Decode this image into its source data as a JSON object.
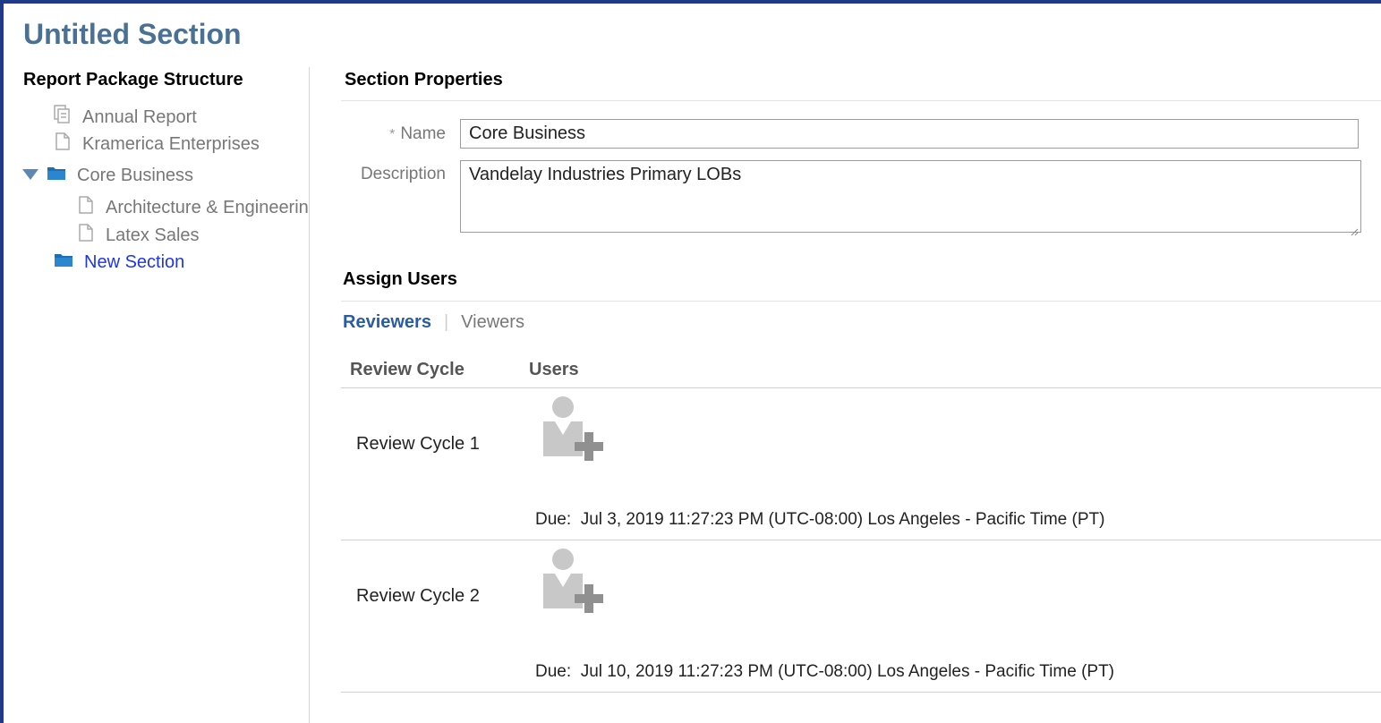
{
  "page": {
    "title": "Untitled Section"
  },
  "tree": {
    "title": "Report Package Structure",
    "items": [
      {
        "label": "Annual Report",
        "icon": "report-package-icon"
      },
      {
        "label": "Kramerica Enterprises",
        "icon": "document-icon"
      },
      {
        "label": "Core Business",
        "icon": "folder-icon",
        "expanded": true
      },
      {
        "label": "Architecture & Engineering",
        "icon": "document-icon"
      },
      {
        "label": "Latex Sales",
        "icon": "document-icon"
      },
      {
        "label": "New Section",
        "icon": "folder-icon",
        "selected": true
      }
    ]
  },
  "properties": {
    "title": "Section Properties",
    "name_label": "Name",
    "required_mark": "*",
    "name_value": "Core Business",
    "description_label": "Description",
    "description_value": "Vandelay Industries Primary LOBs"
  },
  "assign": {
    "title": "Assign Users",
    "tabs": [
      "Reviewers",
      "Viewers"
    ],
    "active_tab": "Reviewers",
    "columns": [
      "Review Cycle",
      "Users"
    ],
    "due_label": "Due:",
    "cycles": [
      {
        "name": "Review Cycle 1",
        "due": "Jul 3, 2019 11:27:23 PM (UTC-08:00) Los Angeles - Pacific Time (PT)"
      },
      {
        "name": "Review Cycle 2",
        "due": "Jul 10, 2019 11:27:23 PM (UTC-08:00) Los Angeles - Pacific Time (PT)"
      }
    ]
  },
  "colors": {
    "frame": "#1e3a8a",
    "title": "#4a7093",
    "link": "#1f36e8",
    "folder": "#1a6fb5",
    "tab_active": "#2a5d9f"
  }
}
